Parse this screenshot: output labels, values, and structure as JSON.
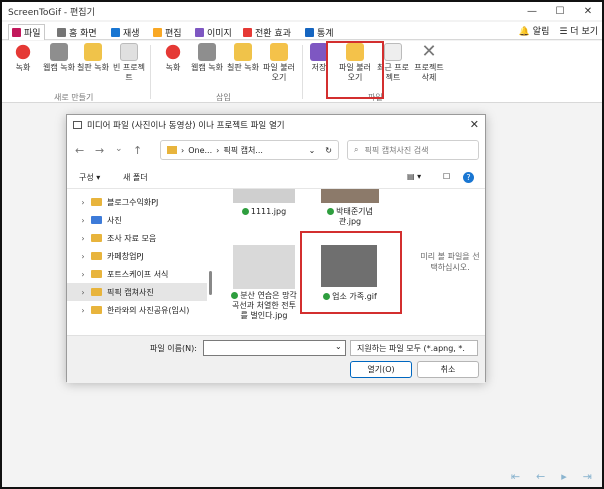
{
  "window": {
    "title": "ScreenToGif - 편집기"
  },
  "tabs": [
    {
      "label": "파일",
      "color": "#c2185b"
    },
    {
      "label": "홈 화면",
      "color": "#757575"
    },
    {
      "label": "재생",
      "color": "#1976d2"
    },
    {
      "label": "편집",
      "color": "#f9a825"
    },
    {
      "label": "이미지",
      "color": "#7e57c2"
    },
    {
      "label": "전환 효과",
      "color": "#e53935"
    },
    {
      "label": "통계",
      "color": "#1565c0"
    }
  ],
  "topright": {
    "notifications": "알림",
    "more": "더 보기"
  },
  "ribbon": {
    "new_group": "새로 만들기",
    "insert_group": "삽입",
    "file_group": "파일",
    "buttons": {
      "record": "녹화",
      "webcam": "웹캠 녹화",
      "board": "칠판 녹화",
      "blank": "빈 프로젝트",
      "insert_record": "녹화",
      "insert_webcam": "웹캠 녹화",
      "insert_board": "칠판 녹화",
      "insert_file": "파일 불러오기",
      "save": "저장",
      "load_file": "파일 불러오기",
      "recent": "최근 프로젝트",
      "delete": "프로젝트 삭제"
    }
  },
  "dialog": {
    "title": "미디어 파일 (사진이나 동영상) 이나 프로젝트 파일 열기",
    "address": {
      "seg1": "One...",
      "seg2": "픽픽 캡처..."
    },
    "search_placeholder": "픽픽 캡쳐사진 검색",
    "organize": "구성",
    "new_folder": "새 폴더",
    "tree": [
      "블로그수익화PJ",
      "사진",
      "조사 자료 모음",
      "카페창업PJ",
      "포트스케이프 서식",
      "픽픽 캡쳐사진",
      "한라와의 사진공유(임시)"
    ],
    "files": [
      {
        "name": "1111.jpg"
      },
      {
        "name": "박태준기념관.jpg"
      },
      {
        "name": "분산 연습은 망각 곡선과 처열한 전투를 벌인다.jpg"
      },
      {
        "name": "업소 가족.gif"
      }
    ],
    "preview_text": "미리 볼 파일을 선택하십시오.",
    "filename_label": "파일 이름(N):",
    "filename_value": "",
    "filetype": "지원하는 파일 모두 (*.apng, *.",
    "open_button": "열기(O)",
    "cancel_button": "취소"
  }
}
